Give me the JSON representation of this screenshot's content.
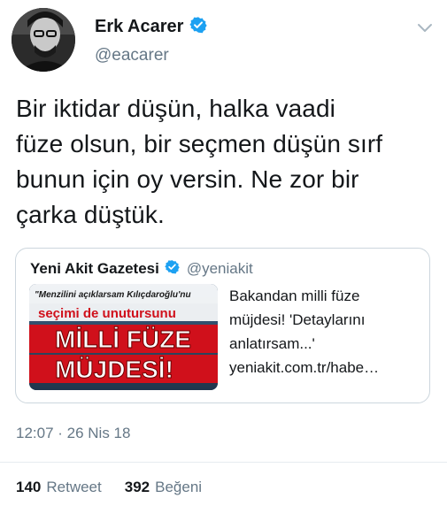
{
  "author": {
    "name": "Erk Acarer",
    "handle": "@eacarer",
    "verified": true
  },
  "tweet": {
    "text": "Bir iktidar düşün, halka vaadi\nfüze olsun, bir seçmen düşün sırf\nbunun için oy versin. Ne zor bir\nçarka düştük."
  },
  "quoted": {
    "name": "Yeni Akit Gazetesi",
    "handle": "@yeniakit",
    "verified": true,
    "text": "Bakandan milli füze\nmüjdesi! 'Detaylarını\nanlatırsam...'\nyeniakit.com.tr/habe…",
    "thumbnail": {
      "line1": "\"Menzilini açıklarsam Kılıçdaroğlu'nu",
      "line2": "seçimi de unutursunu",
      "line3": "MİLLİ FÜZE",
      "line4": "MÜJDESİ!"
    }
  },
  "timestamp": "12:07 · 26 Nis 18",
  "stats": {
    "retweets": "140",
    "retweets_label": "Retweet",
    "likes": "392",
    "likes_label": "Beğeni"
  },
  "colors": {
    "verified": "#1da1f2",
    "secondary_text": "#657786",
    "thumb_red": "#d0101b",
    "thumb_yellow": "#ffd400"
  },
  "icons": {
    "verified": "verified-badge-icon",
    "menu": "chevron-down-icon"
  }
}
